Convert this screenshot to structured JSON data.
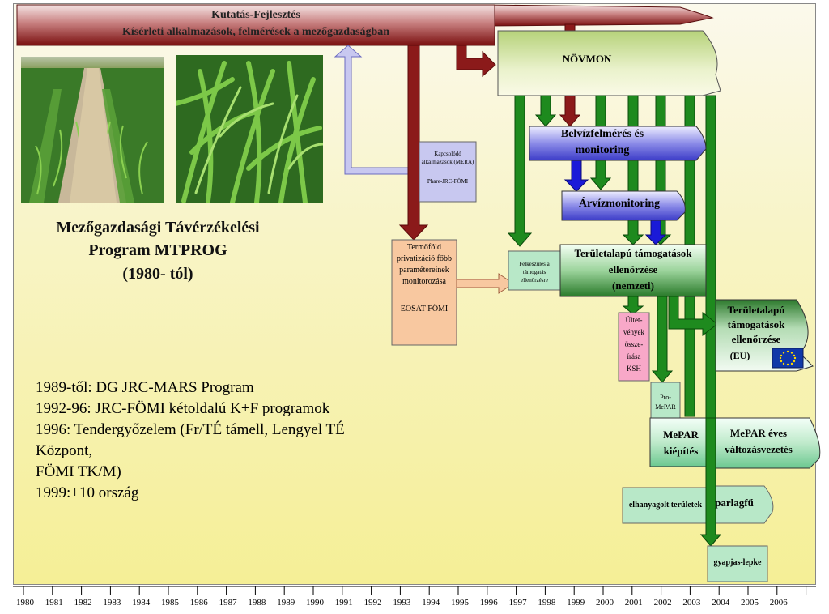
{
  "banner": {
    "line1": "Kutatás-Fejlesztés",
    "line2": "Kísérleti alkalmazások, felmérések a mezőgazdaságban"
  },
  "program": {
    "line1": "Mezőgazdasági Távérzékelési",
    "line2": "Program MTPROG",
    "line3": "(1980- tól)"
  },
  "history": [
    "1989-től: DG JRC-MARS Program",
    "1992-96: JRC-FÖMI kétoldalú K+F programok",
    "1996: Tendergyőzelem (Fr/TÉ támell, Lengyel TÉ",
    "Központ,",
    "FÖMI TK/M)",
    "1999:+10 ország"
  ],
  "boxes": {
    "kapcsolodo_line1": "Kapcsolódó",
    "kapcsolodo_line2": "alkalmazások (MERA)",
    "kapcsolodo_line3": "Phare-JRC-FÖMI",
    "termofold_line1": "Termőföld",
    "termofold_line2": "privatizáció főbb",
    "termofold_line3": "paramétereinek",
    "termofold_line4": "monitorozása",
    "termofold_line5": "EOSAT-FÖMI",
    "novmon": "NÖVMON",
    "belviz_line1": "Belvízfelmérés és",
    "belviz_line2": "monitoring",
    "arviz": "Árvízmonitoring",
    "felkeszules_line1": "Felkészülés a",
    "felkeszules_line2": "támogatás",
    "felkeszules_line3": "ellenőrzésre",
    "teruletalapu_nemzeti_line1": "Területalapú támogatások",
    "teruletalapu_nemzeti_line2": "ellenőrzése",
    "teruletalapu_nemzeti_line3": "(nemzeti)",
    "teruletalapu_eu_line1": "Területalapú",
    "teruletalapu_eu_line2": "támogatások",
    "teruletalapu_eu_line3": "ellenőrzése",
    "teruletalapu_eu_line4": "(EU)",
    "ultetvenyek_line1": "Ültet-",
    "ultetvenyek_line2": "vények",
    "ultetvenyek_line3": "össze-",
    "ultetvenyek_line4": "írása",
    "ultetvenyek_line5": "KSH",
    "promepar_line1": "Pro-",
    "promepar_line2": "MePAR",
    "mepar_kiepites_line1": "MePAR",
    "mepar_kiepites_line2": "kiépítés",
    "mepar_eves_line1": "MePAR éves",
    "mepar_eves_line2": "változásvezetés",
    "elhanyagolt": "elhanyagolt területek",
    "parlagfu": "parlagfű",
    "gyapjas": "gyapjas-lepke"
  },
  "timeline": {
    "years": [
      "1980",
      "1981",
      "1982",
      "1983",
      "1984",
      "1985",
      "1986",
      "1987",
      "1988",
      "1989",
      "1990",
      "1991",
      "1992",
      "1993",
      "1994",
      "1995",
      "1996",
      "1997",
      "1998",
      "1999",
      "2000",
      "2001",
      "2002",
      "2003",
      "2004",
      "2005",
      "2006"
    ]
  },
  "colors": {
    "dark_red": "#8b1a1a",
    "dark_green": "#1e7a1e",
    "lavender": "#c8c8f0",
    "peach": "#f8c8a0",
    "teal_green": "#b8e8c8",
    "pink": "#f8a8c8",
    "blue": "#1a1ad8"
  }
}
